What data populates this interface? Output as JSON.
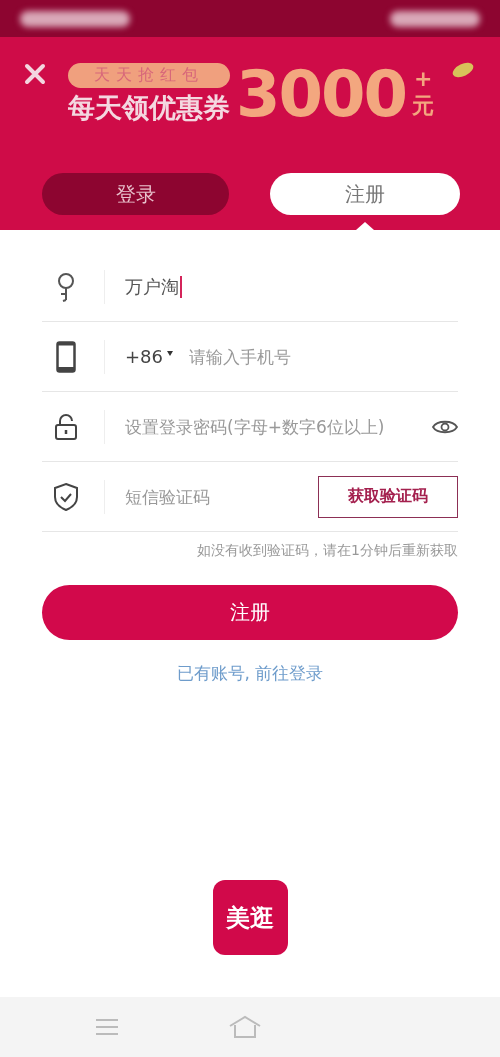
{
  "banner": {
    "badge": "天天抢红包",
    "headline": "每天领优惠券",
    "amount": "3000",
    "plus": "+",
    "unit": "元"
  },
  "tabs": [
    {
      "label": "登录",
      "selected": false
    },
    {
      "label": "注册",
      "selected": true
    }
  ],
  "fields": [
    {
      "kind": "name",
      "value": "万户淘",
      "focused": true
    },
    {
      "kind": "phone",
      "prefix": "+86",
      "placeholder": "请输入手机号"
    },
    {
      "kind": "password",
      "placeholder": "设置登录密码(字母+数字6位以上)"
    },
    {
      "kind": "code",
      "placeholder": "短信验证码",
      "button": "获取验证码"
    }
  ],
  "hint": "如没有收到验证码，请在1分钟后重新获取",
  "submit": "注册",
  "login_link": "已有账号, 前往登录",
  "logo": "美逛"
}
